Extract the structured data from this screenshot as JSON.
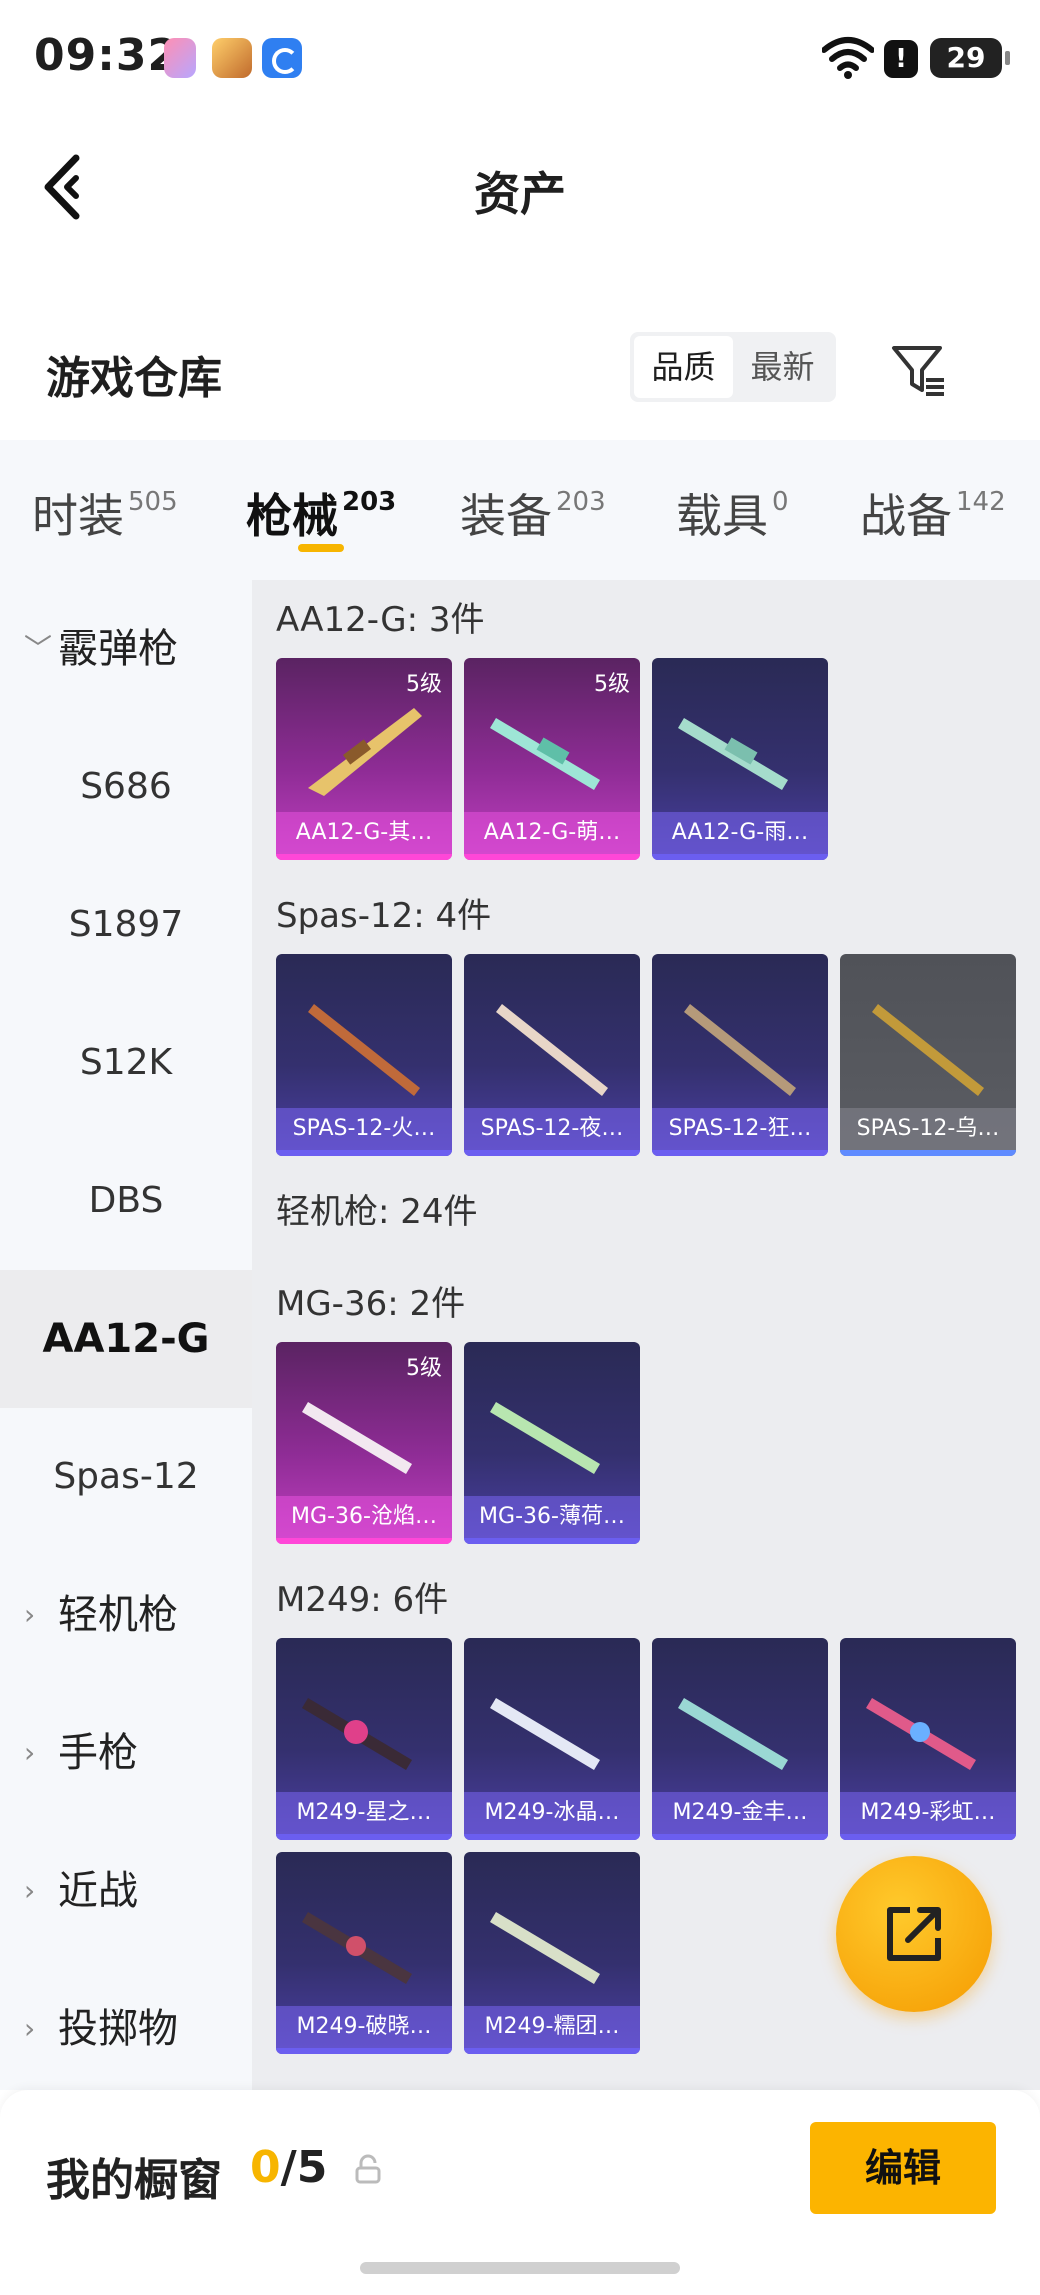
{
  "status_bar": {
    "time": "09:32",
    "battery": "29",
    "alert": "!"
  },
  "header": {
    "title": "资产"
  },
  "section": {
    "title": "游戏仓库",
    "sort_options": [
      "品质",
      "最新"
    ],
    "sort_active": "品质"
  },
  "tabs": [
    {
      "label": "时装",
      "count": "505"
    },
    {
      "label": "枪械",
      "count": "203"
    },
    {
      "label": "装备",
      "count": "203"
    },
    {
      "label": "载具",
      "count": "0"
    },
    {
      "label": "战备",
      "count": "142"
    }
  ],
  "sidebar": {
    "items": [
      {
        "label": "霰弹枪",
        "type": "group",
        "expanded": true
      },
      {
        "label": "S686"
      },
      {
        "label": "S1897"
      },
      {
        "label": "S12K"
      },
      {
        "label": "DBS"
      },
      {
        "label": "AA12-G",
        "active": true
      },
      {
        "label": "Spas-12"
      },
      {
        "label": "轻机枪",
        "type": "group"
      },
      {
        "label": "手枪",
        "type": "group"
      },
      {
        "label": "近战",
        "type": "group"
      },
      {
        "label": "投掷物",
        "type": "group"
      }
    ]
  },
  "content": {
    "groups": [
      {
        "title": "AA12-G: 3件",
        "cards": [
          {
            "name": "AA12-G-其…",
            "level": "5级",
            "quality": "q5"
          },
          {
            "name": "AA12-G-萌…",
            "level": "5级",
            "quality": "q5"
          },
          {
            "name": "AA12-G-雨…",
            "level": "",
            "quality": "epic"
          }
        ]
      },
      {
        "title": "Spas-12: 4件",
        "cards": [
          {
            "name": "SPAS-12-火…",
            "level": "",
            "quality": "epic"
          },
          {
            "name": "SPAS-12-夜…",
            "level": "",
            "quality": "epic"
          },
          {
            "name": "SPAS-12-狂…",
            "level": "",
            "quality": "epic"
          },
          {
            "name": "SPAS-12-乌…",
            "level": "",
            "quality": "gray"
          }
        ]
      },
      {
        "title": "轻机枪: 24件",
        "cards": []
      },
      {
        "title": "MG-36: 2件",
        "cards": [
          {
            "name": "MG-36-沧焰…",
            "level": "5级",
            "quality": "q5"
          },
          {
            "name": "MG-36-薄荷…",
            "level": "",
            "quality": "epic"
          }
        ]
      },
      {
        "title": "M249: 6件",
        "cards": [
          {
            "name": "M249-星之…",
            "level": "",
            "quality": "epic"
          },
          {
            "name": "M249-冰晶…",
            "level": "",
            "quality": "epic"
          },
          {
            "name": "M249-金丰…",
            "level": "",
            "quality": "epic"
          },
          {
            "name": "M249-彩虹…",
            "level": "",
            "quality": "epic"
          },
          {
            "name": "M249-破晓…",
            "level": "",
            "quality": "epic"
          },
          {
            "name": "M249-糯团…",
            "level": "",
            "quality": "epic"
          }
        ]
      }
    ]
  },
  "bottom": {
    "window_label": "我的橱窗",
    "count_current": "0",
    "count_total": "/5",
    "edit_label": "编辑"
  },
  "colors": {
    "accent": "#f7b500",
    "quality5": "#c03fc0",
    "epic": "#4b3fa3"
  }
}
